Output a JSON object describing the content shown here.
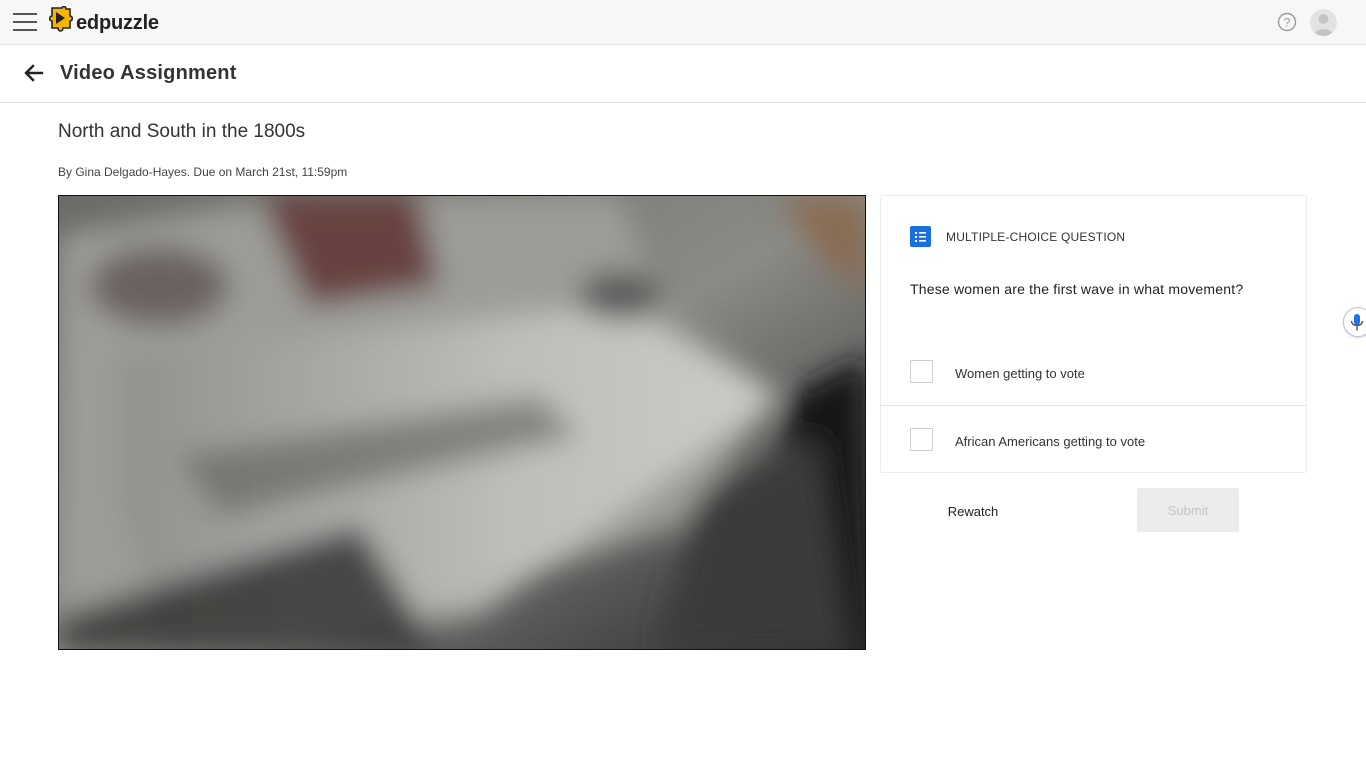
{
  "app": {
    "logo_text": "edpuzzle",
    "brand_color": "#f7b500"
  },
  "topbar": {
    "menu_icon": "hamburger-icon",
    "help_icon": "question-circle-icon",
    "avatar_icon": "user-avatar-icon"
  },
  "header": {
    "back_icon": "arrow-left-icon",
    "title": "Video Assignment"
  },
  "assignment": {
    "title": "North and South in the 1800s",
    "meta": "By Gina Delgado-Hayes. Due on March 21st, 11:59pm"
  },
  "question": {
    "type_icon": "checklist-icon",
    "type_label": "MULTIPLE-CHOICE QUESTION",
    "text": "These women are the first wave in what movement?",
    "options": [
      {
        "label": "Women getting to vote",
        "checked": false
      },
      {
        "label": "African Americans getting to vote",
        "checked": false
      }
    ],
    "accent_color": "#1a6fe0"
  },
  "actions": {
    "rewatch_label": "Rewatch",
    "submit_label": "Submit",
    "submit_disabled": true
  },
  "widgets": {
    "mic_icon": "microphone-icon"
  }
}
